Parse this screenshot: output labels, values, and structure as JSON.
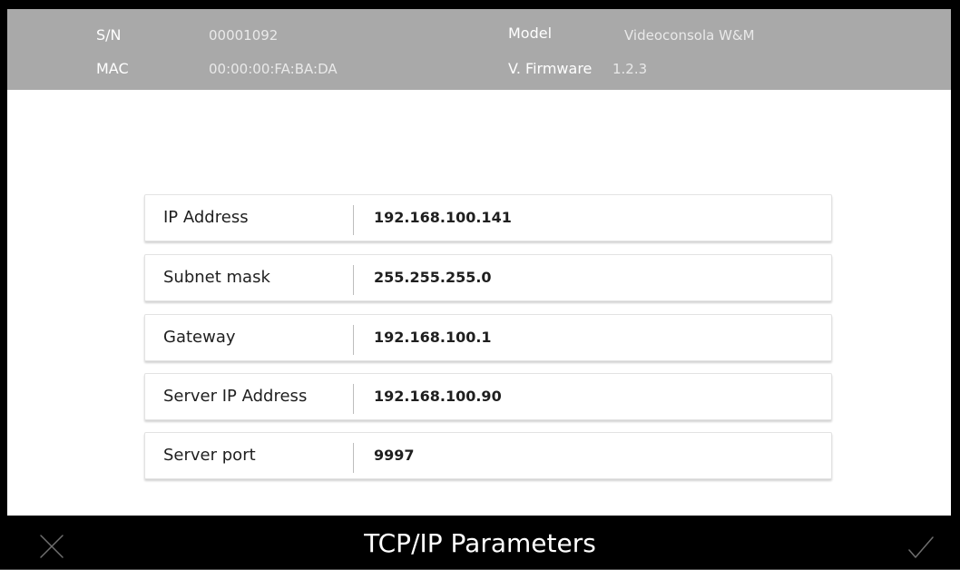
{
  "header": {
    "sn_label": "S/N",
    "sn_value": "00001092",
    "model_label": "Model",
    "model_value": "Videoconsola W&M",
    "mac_label": "MAC",
    "mac_value": "00:00:00:FA:BA:DA",
    "firmware_label": "V. Firmware",
    "firmware_value": "1.2.3"
  },
  "form": {
    "rows": [
      {
        "label": "IP Address",
        "value": "192.168.100.141"
      },
      {
        "label": "Subnet mask",
        "value": "255.255.255.0"
      },
      {
        "label": "Gateway",
        "value": "192.168.100.1"
      },
      {
        "label": "Server IP Address",
        "value": "192.168.100.90"
      },
      {
        "label": "Server port",
        "value": "9997"
      }
    ]
  },
  "footer": {
    "title": "TCP/IP Parameters",
    "cancel_icon": "close-icon",
    "confirm_icon": "check-icon"
  },
  "colors": {
    "header_bg": "#a9a9a9",
    "footer_bg": "#000000",
    "row_border": "#e3e3e3",
    "text": "#1f1f1f"
  }
}
